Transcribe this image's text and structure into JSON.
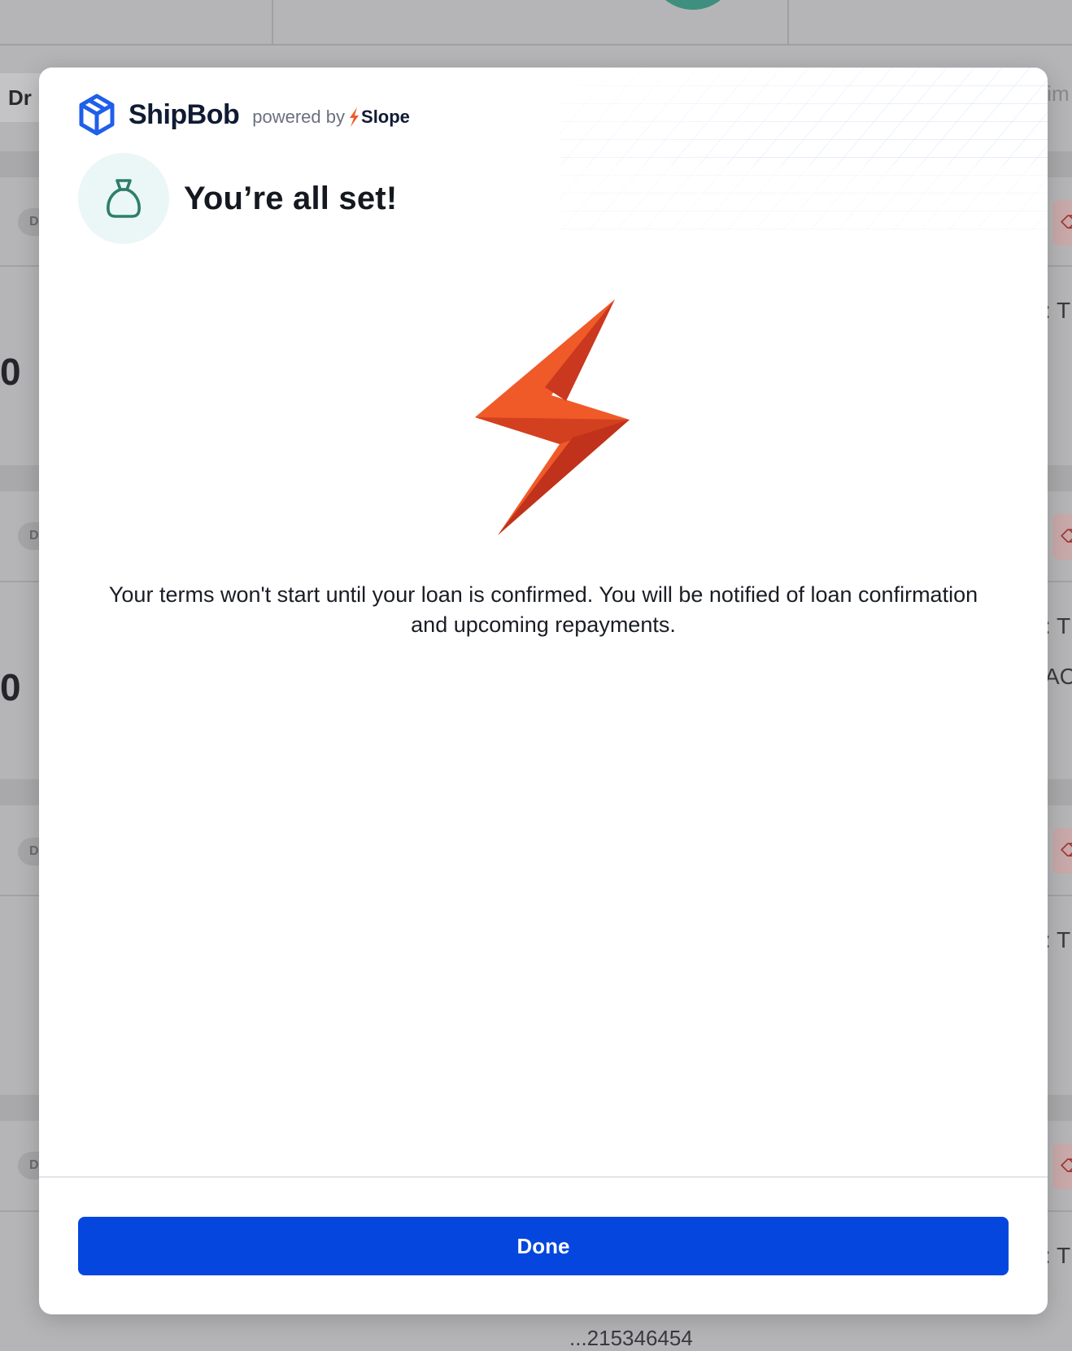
{
  "background": {
    "tab_label": "Dr",
    "right_tab_label": "tim",
    "pill_labels": [
      "D",
      "DR",
      "D",
      "D"
    ],
    "big_values": [
      "0",
      "0"
    ],
    "right_texts": [
      ": T",
      ": T",
      "AC",
      ": T",
      ": T"
    ],
    "bottom_text": "...215346454"
  },
  "modal": {
    "brand": "ShipBob",
    "powered_by": "powered by",
    "partner": "Slope",
    "title": "You’re all set!",
    "message": "Your terms won't start until your loan is confirmed. You will be notified of loan confirmation and upcoming repayments.",
    "done_label": "Done"
  },
  "colors": {
    "primary": "#0547de",
    "brand_blue": "#1f5fea",
    "bolt_orange": "#f05a28",
    "bolt_dark": "#c0321c",
    "bag_green": "#2e7d6b"
  }
}
